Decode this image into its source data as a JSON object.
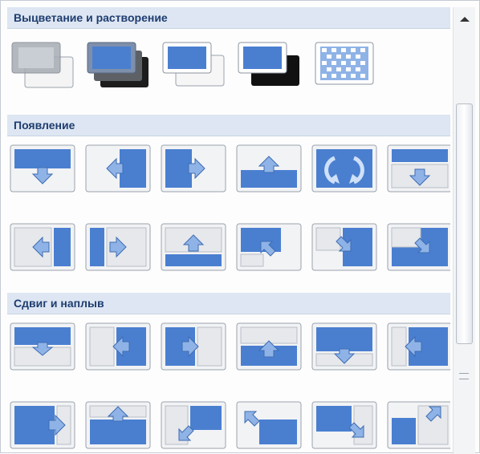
{
  "sections": [
    {
      "title": "Выцветание и растворение"
    },
    {
      "title": "Появление"
    },
    {
      "title": "Сдвиг и наплыв"
    }
  ],
  "colors": {
    "blue": "#4a7fd0",
    "header_bg": "#dde6f2",
    "header_text": "#1f3d70"
  },
  "icons": {
    "fade": [
      "fade-smoothly-icon",
      "fade-through-black-icon",
      "fade-wipe-icon",
      "fade-through-black-wipe-icon",
      "dissolve-icon"
    ],
    "appear": [
      "cover-down-icon",
      "cover-left-icon",
      "cover-right-icon",
      "cover-up-icon",
      "cover-rotate-icon",
      "push-down-icon",
      "push-left-icon",
      "push-right-icon",
      "push-up-icon",
      "cover-up-left-icon",
      "cover-up-right-icon",
      "cover-down-right-icon"
    ],
    "shift": [
      "shift-down-icon",
      "shift-left-icon",
      "shift-right-icon",
      "shift-up-icon",
      "uncover-down-icon",
      "uncover-left-icon",
      "uncover-right-icon",
      "uncover-up-icon",
      "uncover-down-left-icon",
      "uncover-up-left-icon",
      "uncover-down-right-icon",
      "uncover-up-right-icon"
    ]
  }
}
